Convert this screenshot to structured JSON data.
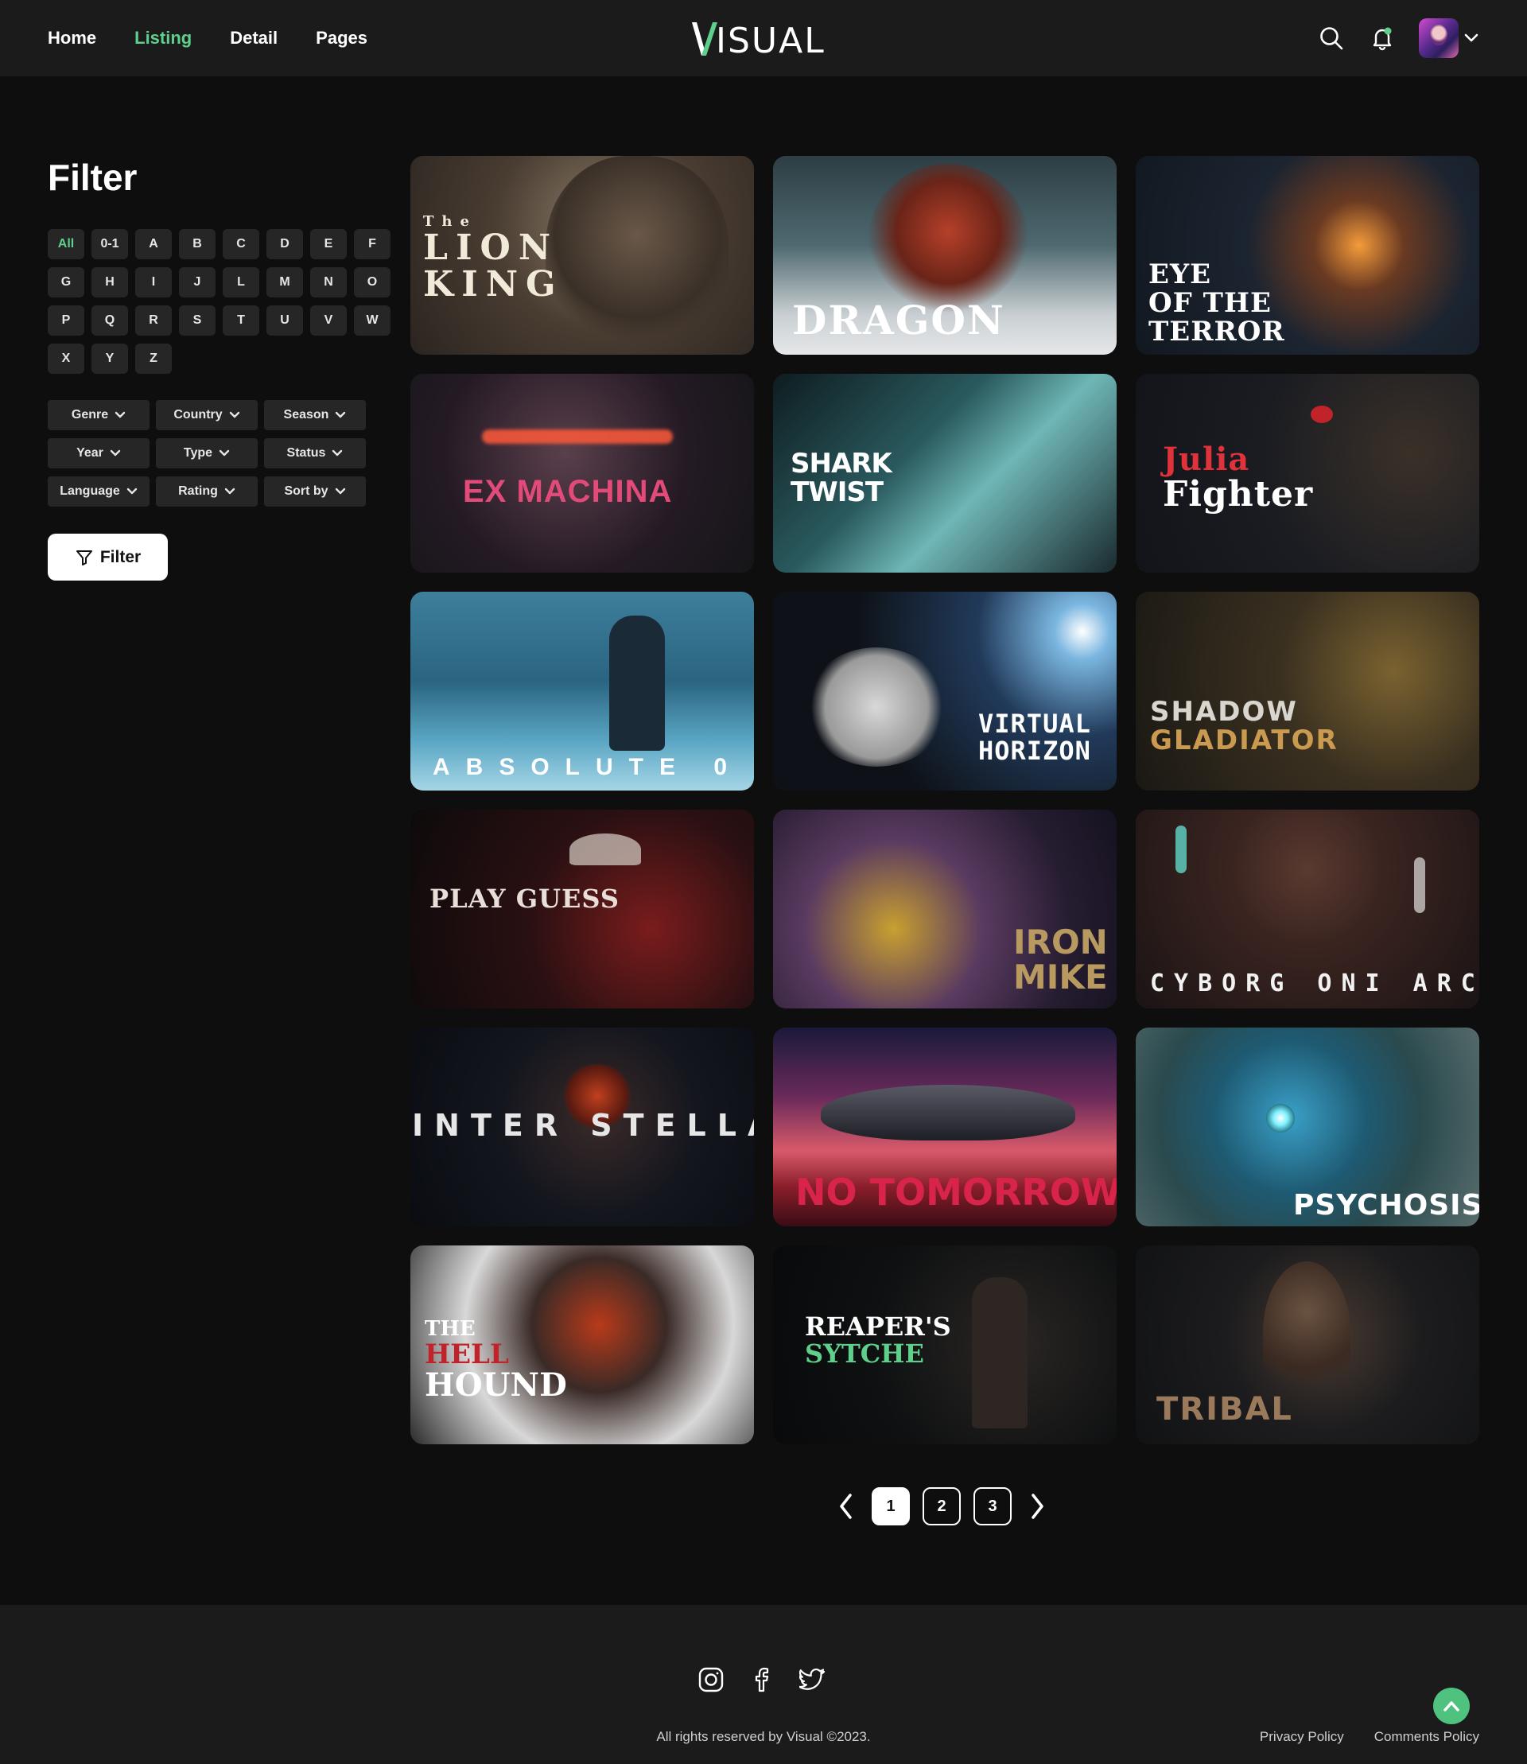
{
  "header": {
    "nav": [
      "Home",
      "Listing",
      "Detail",
      "Pages"
    ],
    "active_nav": "Listing",
    "logo_text": "ISUAL",
    "accent": "#5fd08c"
  },
  "sidebar": {
    "title": "Filter",
    "letters": [
      "All",
      "0-1",
      "A",
      "B",
      "C",
      "D",
      "E",
      "F",
      "G",
      "H",
      "I",
      "J",
      "L",
      "M",
      "N",
      "O",
      "P",
      "Q",
      "R",
      "S",
      "T",
      "U",
      "V",
      "W",
      "X",
      "Y",
      "Z"
    ],
    "active_letter": "All",
    "dropdowns": [
      "Genre",
      "Country",
      "Season",
      "Year",
      "Type",
      "Status",
      "Language",
      "Rating",
      "Sort by"
    ],
    "filter_button": "Filter"
  },
  "movies": [
    {
      "title_lines": [
        "The",
        "LION",
        "KING"
      ],
      "bg": "#5a4a3e"
    },
    {
      "title_lines": [
        "DRAGON"
      ],
      "bg": "#3f5258"
    },
    {
      "title_lines": [
        "EYE",
        "OF THE",
        "TERROR"
      ],
      "bg": "#1c2530"
    },
    {
      "title_lines": [
        "EX MACHINA"
      ],
      "bg": "#1a1a22"
    },
    {
      "title_lines": [
        "SHARK",
        "TWIST"
      ],
      "bg": "#26454a"
    },
    {
      "title_lines": [
        "Julia",
        "Fighter"
      ],
      "bg": "#161a22"
    },
    {
      "title_lines": [
        "ABSOLUTE 0"
      ],
      "bg": "#2d6b86"
    },
    {
      "title_lines": [
        "VIRTUAL",
        "HORIZON"
      ],
      "bg": "#101820"
    },
    {
      "title_lines": [
        "SHADOW",
        "GLADIATOR"
      ],
      "bg": "#23201a"
    },
    {
      "title_lines": [
        "PLAY GUESS"
      ],
      "bg": "#1a0f10"
    },
    {
      "title_lines": [
        "IRON",
        "MIKE"
      ],
      "bg": "#2a1f33"
    },
    {
      "title_lines": [
        "CYBORG ONI ARC"
      ],
      "bg": "#221818"
    },
    {
      "title_lines": [
        "INTER STELLAR"
      ],
      "bg": "#0e1016"
    },
    {
      "title_lines": [
        "NO TOMORROW"
      ],
      "bg": "#5a1e2e"
    },
    {
      "title_lines": [
        "PSYCHOSIS"
      ],
      "bg": "#1e3a40"
    },
    {
      "title_lines": [
        "THE",
        "HELL",
        "HOUND"
      ],
      "bg": "#2a2a2a"
    },
    {
      "title_lines": [
        "REAPER'S",
        "SYTCHE"
      ],
      "bg": "#0b0d0e"
    },
    {
      "title_lines": [
        "TRIBAL"
      ],
      "bg": "#141618"
    }
  ],
  "pagination": {
    "pages": [
      "1",
      "2",
      "3"
    ],
    "active": "1"
  },
  "footer": {
    "copyright": "All rights reserved by Visual ©2023.",
    "links": [
      "Privacy Policy",
      "Comments Policy"
    ]
  }
}
